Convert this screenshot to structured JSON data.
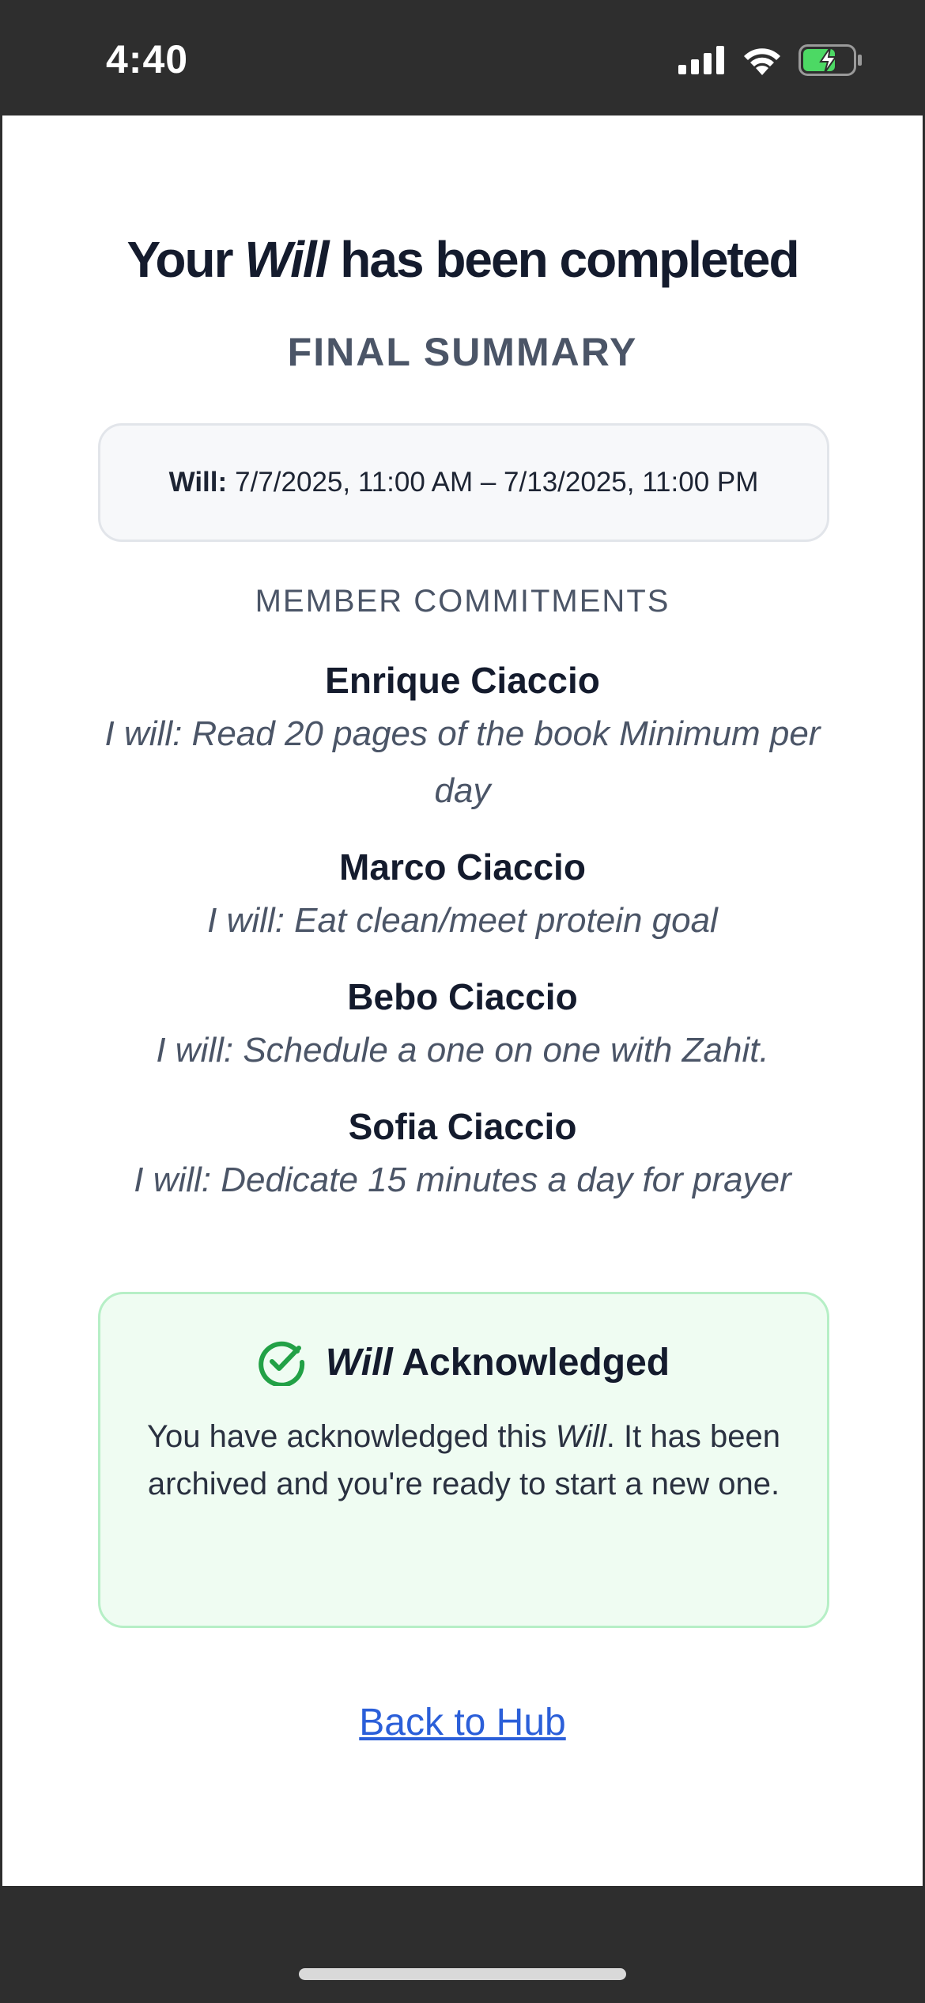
{
  "status_bar": {
    "time": "4:40",
    "icons": [
      "signal-icon",
      "wifi-icon",
      "battery-charging-icon"
    ],
    "battery_color": "#4cd964"
  },
  "header": {
    "title_prefix": "Your",
    "title_italic": "Will",
    "title_suffix": "has been completed",
    "subtitle": "FINAL SUMMARY"
  },
  "summary": {
    "will_label": "Will:",
    "will_range": "7/7/2025, 11:00 AM – 7/13/2025, 11:00 PM"
  },
  "members_section": {
    "label": "MEMBER COMMITMENTS",
    "members": [
      {
        "name": "Enrique Ciaccio",
        "commitment": "I will: Read 20 pages of the book Minimum per day"
      },
      {
        "name": "Marco Ciaccio",
        "commitment": "I will: Eat clean/meet protein goal"
      },
      {
        "name": "Bebo Ciaccio",
        "commitment": "I will: Schedule a one on one with Zahit."
      },
      {
        "name": "Sofia Ciaccio",
        "commitment": "I will: Dedicate 15 minutes a day for prayer"
      }
    ]
  },
  "acknowledgement": {
    "icon": "check-circle-icon",
    "title_italic": "Will",
    "title_rest": "Acknowledged",
    "body_prefix": "You have acknowledged this",
    "body_italic": "Will",
    "body_suffix": ". It has been archived and you're ready to start a new one.",
    "accent_color": "#22a146"
  },
  "footer": {
    "back_label": "Back to Hub"
  }
}
